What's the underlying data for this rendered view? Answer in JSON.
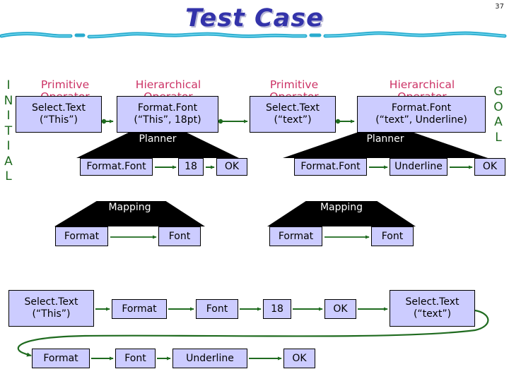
{
  "slide": {
    "title": "Test Case",
    "page_number": "37",
    "title_color": "#3333AA",
    "accent_line_color": "#29ABCE",
    "node_fill": "#CCCCFF",
    "node_border": "#000000",
    "arrow_color": "#1F6B1F",
    "header_color": "#CC3366",
    "side_label_color": "#1F6B1F",
    "band_fill": "#000000",
    "band_text_color": "#FFFFFF"
  },
  "side_labels": {
    "left": {
      "name": "INITIAL",
      "letters": [
        "I",
        "N",
        "I",
        "T",
        "I",
        "A",
        "L"
      ]
    },
    "right": {
      "name": "GOAL",
      "letters": [
        "G",
        "O",
        "A",
        "L"
      ]
    }
  },
  "column_headers": [
    {
      "line1": "Primitive",
      "line2": "Operator"
    },
    {
      "line1": "Hierarchical",
      "line2": "Operator"
    },
    {
      "line1": "Primitive",
      "line2": "Operator"
    },
    {
      "line1": "Hierarchical",
      "line2": "Operator"
    }
  ],
  "operator_row": [
    {
      "line1": "Select.Text",
      "line2": "(“This”)"
    },
    {
      "line1": "Format.Font",
      "line2": "(“This”, 18pt)"
    },
    {
      "line1": "Select.Text",
      "line2": "(“text”)"
    },
    {
      "line1": "Format.Font",
      "line2": "(“text”, Underline)"
    }
  ],
  "bands": {
    "planner": "Planner",
    "mapping": "Mapping"
  },
  "planner_left": {
    "band_label": "Planner",
    "steps": [
      "Format.Font",
      "18",
      "OK"
    ]
  },
  "planner_right": {
    "band_label": "Planner",
    "steps": [
      "Format.Font",
      "Underline",
      "OK"
    ]
  },
  "mapping_left": {
    "band_label": "Mapping",
    "steps": [
      "Format",
      "Font"
    ]
  },
  "mapping_right": {
    "band_label": "Mapping",
    "steps": [
      "Format",
      "Font"
    ]
  },
  "trace_row_1": [
    {
      "line1": "Select.Text",
      "line2": "(“This”)"
    },
    {
      "line1": "Format",
      "line2": ""
    },
    {
      "line1": "Font",
      "line2": ""
    },
    {
      "line1": "18",
      "line2": ""
    },
    {
      "line1": "OK",
      "line2": ""
    },
    {
      "line1": "Select.Text",
      "line2": "(“text”)"
    }
  ],
  "trace_row_2": [
    {
      "line1": "Format",
      "line2": ""
    },
    {
      "line1": "Font",
      "line2": ""
    },
    {
      "line1": "Underline",
      "line2": ""
    },
    {
      "line1": "OK",
      "line2": ""
    }
  ]
}
